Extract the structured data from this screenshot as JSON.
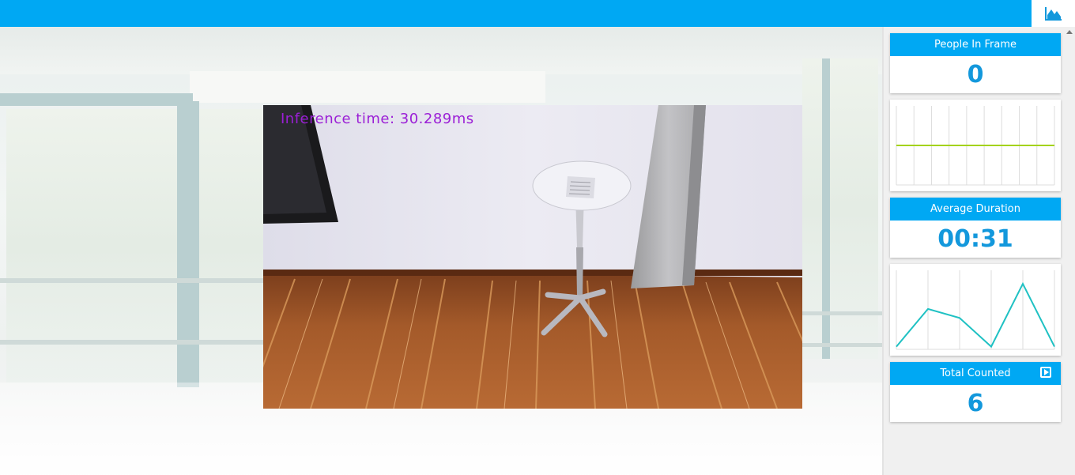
{
  "app": {
    "accent_color": "#00a8f3",
    "toggle_icon": "area-chart-icon"
  },
  "video": {
    "inference_label": "Inference time: 30.289ms"
  },
  "stats": {
    "people_in_frame": {
      "title": "People In Frame",
      "value": "0"
    },
    "average_duration": {
      "title": "Average Duration",
      "value": "00:31"
    },
    "total_counted": {
      "title": "Total Counted",
      "value": "6",
      "action_icon": "play-icon"
    }
  },
  "chart_data": [
    {
      "type": "line",
      "x": [
        0,
        1,
        2,
        3,
        4,
        5,
        6,
        7,
        8,
        9
      ],
      "series": [
        {
          "values": [
            0,
            0,
            0,
            0,
            0,
            0,
            0,
            0,
            0,
            0
          ],
          "color": "#a4d21c"
        }
      ],
      "ylim": [
        -1,
        1
      ],
      "grid": true
    },
    {
      "type": "line",
      "x": [
        0,
        1,
        2,
        3,
        4,
        5
      ],
      "series": [
        {
          "values": [
            0,
            42,
            32,
            0,
            70,
            0
          ],
          "color": "#1fc1c3"
        }
      ],
      "ylim": [
        -3,
        85
      ],
      "grid": true
    }
  ]
}
